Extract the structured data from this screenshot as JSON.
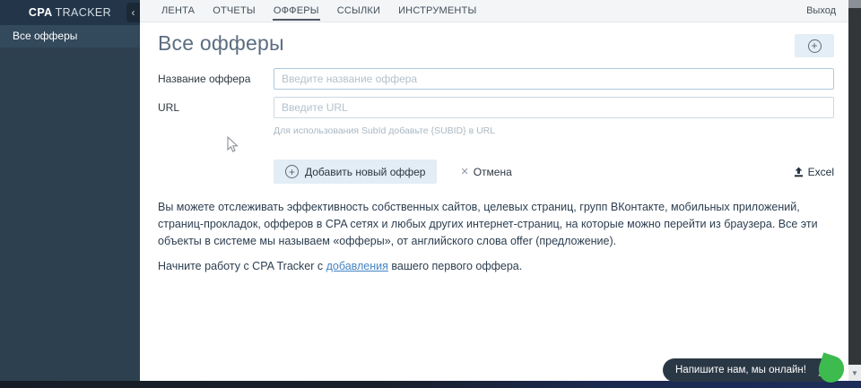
{
  "logo": {
    "brand_bold": "CPA",
    "brand_light": "TRACKER"
  },
  "sidebar": {
    "items": [
      {
        "label": "Все офферы"
      }
    ]
  },
  "nav": {
    "tabs": [
      {
        "label": "ЛЕНТА"
      },
      {
        "label": "ОТЧЕТЫ"
      },
      {
        "label": "ОФФЕРЫ",
        "active": true
      },
      {
        "label": "ССЫЛКИ"
      },
      {
        "label": "ИНСТРУМЕНТЫ"
      }
    ],
    "logout_label": "Выход"
  },
  "main": {
    "title": "Все офферы",
    "form": {
      "name_label": "Название оффера",
      "name_placeholder": "Введите название оффера",
      "url_label": "URL",
      "url_placeholder": "Введите URL",
      "url_hint": "Для использования SubId добавьте {SUBID} в URL",
      "submit_label": "Добавить новый оффер",
      "cancel_label": "Отмена",
      "excel_label": "Excel"
    },
    "description": "Вы можете отслеживать эффективность собственных сайтов, целевых страниц, групп ВКонтакте, мобильных приложений, страниц-прокладок, офферов в CPA сетях и любых других интернет-страниц, на которые можно перейти из браузера. Все эти объекты в системе мы называем «офферы», от английского слова offer (предложение).",
    "start_text_before": "Начните работу с CPA Tracker с ",
    "start_link": "добавления",
    "start_text_after": " вашего первого оффера."
  },
  "chat": {
    "message": "Напишите нам, мы онлайн!",
    "brand": "jivo"
  },
  "icons": {
    "plus": "+",
    "close": "✕",
    "chevron_left": "‹",
    "scroll_down": "▼"
  },
  "colors": {
    "sidebar_bg": "#2d4050",
    "logo_bar_bg": "#233649",
    "sidebar_item_bg": "#33495c",
    "nav_bg": "#f3f5f7",
    "accent_button_bg": "#e2edf5",
    "link": "#4584c4",
    "jivo_green": "#3dbb4e",
    "chat_bg": "#2a3744",
    "title": "#5b6d80"
  }
}
